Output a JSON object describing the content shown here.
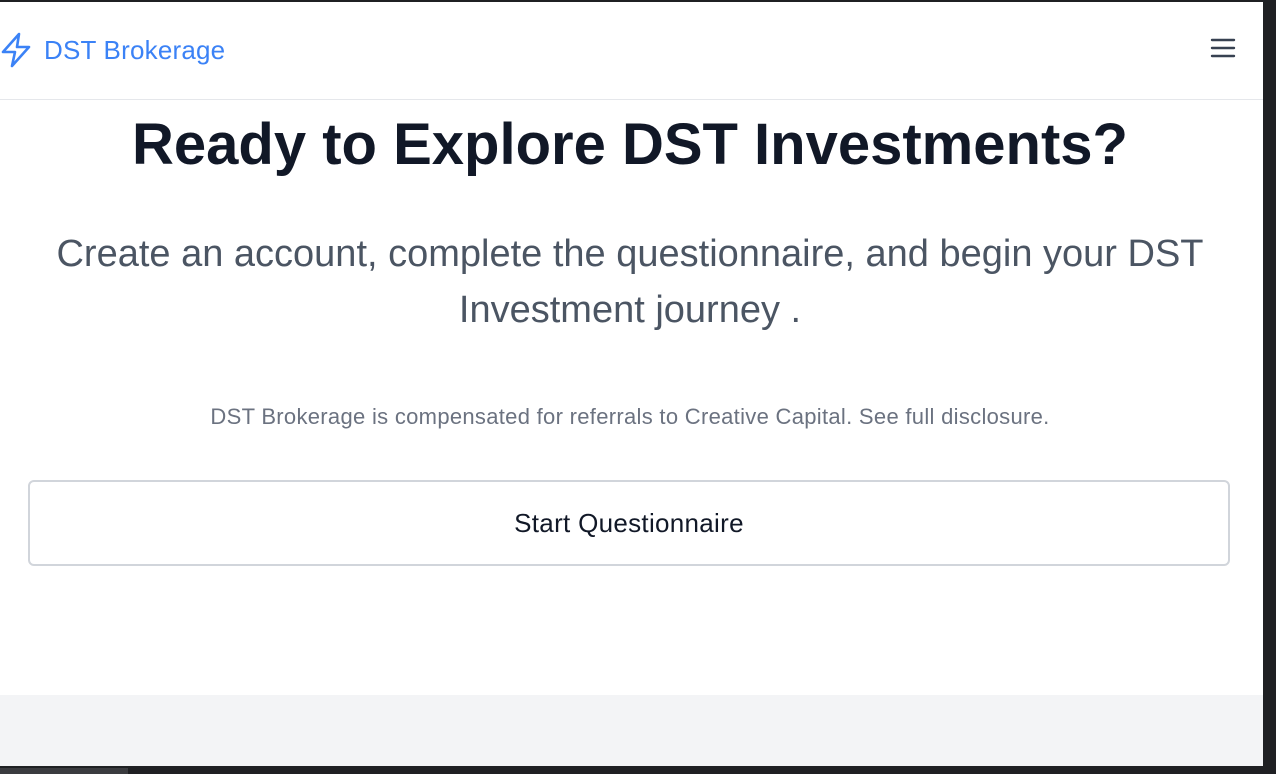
{
  "navbar": {
    "brand_label": "DST Brokerage",
    "brand_icon": "bolt-icon",
    "menu_icon": "hamburger-menu-icon"
  },
  "hero": {
    "headline": "Ready to Explore DST Investments?",
    "subhead": "Create an account, complete the questionnaire, and begin your DST Investment journey .",
    "disclosure": "DST Brokerage is compensated for referrals to Creative Capital. See full disclosure.",
    "cta_label": "Start Questionnaire"
  },
  "colors": {
    "brand": "#3b82f6",
    "headline": "#111827",
    "body_text": "#4b5563",
    "muted_text": "#6b7280",
    "border": "#d1d5db",
    "footer_bg": "#f3f4f6"
  }
}
